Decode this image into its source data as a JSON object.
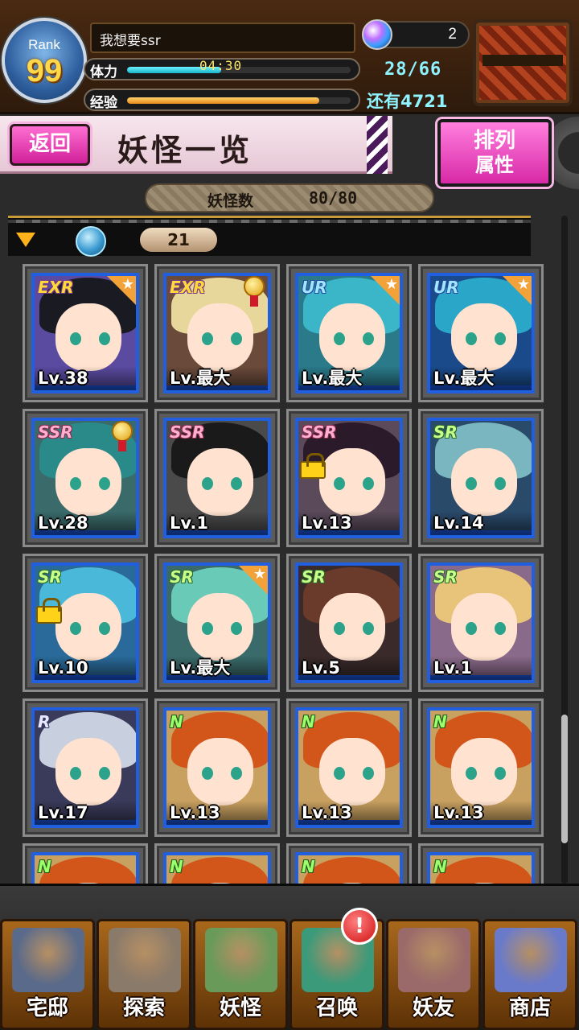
{
  "header": {
    "rank_label": "Rank",
    "rank_value": "99",
    "player_name": "我想要ssr",
    "stamina_label": "体力",
    "stamina_timer": "04:30",
    "stamina_fill": 0.42,
    "stamina_count": "28/66",
    "exp_label": "经验",
    "exp_fill": 0.86,
    "exp_remain": "还有4721",
    "orb_count": "2"
  },
  "title_bar": {
    "back_label": "返回",
    "title": "妖怪一览",
    "sort_line1": "排列",
    "sort_line2": "属性"
  },
  "count_bar": {
    "label": "妖怪数",
    "value": "80/80"
  },
  "filter": {
    "level_value": "21"
  },
  "cards": [
    {
      "rarity": "EXR",
      "lv": "Lv.38",
      "star": true,
      "medal": false,
      "lock": false,
      "hair": "#1a1a22",
      "bg": "#5a4aa0"
    },
    {
      "rarity": "EXR",
      "lv": "Lv.最大",
      "star": false,
      "medal": true,
      "lock": false,
      "hair": "#e7d79a",
      "bg": "#6a4a3a"
    },
    {
      "rarity": "UR",
      "lv": "Lv.最大",
      "star": true,
      "medal": false,
      "lock": false,
      "hair": "#3ab6c8",
      "bg": "#2a7a8a"
    },
    {
      "rarity": "UR",
      "lv": "Lv.最大",
      "star": true,
      "medal": false,
      "lock": false,
      "hair": "#2aa6c8",
      "bg": "#1a4a8a"
    },
    {
      "rarity": "SSR",
      "lv": "Lv.28",
      "star": false,
      "medal": true,
      "lock": false,
      "hair": "#2a8a8a",
      "bg": "#3a6a6a"
    },
    {
      "rarity": "SSR",
      "lv": "Lv.1",
      "star": false,
      "medal": false,
      "lock": false,
      "hair": "#1a1a1a",
      "bg": "#4a4a4a"
    },
    {
      "rarity": "SSR",
      "lv": "Lv.13",
      "star": false,
      "medal": false,
      "lock": true,
      "hair": "#2a1a2a",
      "bg": "#5a4a5a"
    },
    {
      "rarity": "SR",
      "lv": "Lv.14",
      "star": false,
      "medal": false,
      "lock": false,
      "hair": "#7ab6c0",
      "bg": "#2a4a6a"
    },
    {
      "rarity": "SR",
      "lv": "Lv.10",
      "star": false,
      "medal": false,
      "lock": true,
      "hair": "#4ab8d8",
      "bg": "#2a6a9a"
    },
    {
      "rarity": "SR",
      "lv": "Lv.最大",
      "star": true,
      "medal": false,
      "lock": false,
      "hair": "#6acab8",
      "bg": "#3a6a6a"
    },
    {
      "rarity": "SR",
      "lv": "Lv.5",
      "star": false,
      "medal": false,
      "lock": false,
      "hair": "#6a3a2a",
      "bg": "#3a2a2a"
    },
    {
      "rarity": "SR",
      "lv": "Lv.1",
      "star": false,
      "medal": false,
      "lock": false,
      "hair": "#e8c47a",
      "bg": "#8a6a8a"
    },
    {
      "rarity": "R",
      "lv": "Lv.17",
      "star": false,
      "medal": false,
      "lock": false,
      "hair": "#c8d0e0",
      "bg": "#3a3a5a"
    },
    {
      "rarity": "N",
      "lv": "Lv.13",
      "star": false,
      "medal": false,
      "lock": false,
      "hair": "#d2561a",
      "bg": "#c8a060"
    },
    {
      "rarity": "N",
      "lv": "Lv.13",
      "star": false,
      "medal": false,
      "lock": false,
      "hair": "#d2561a",
      "bg": "#c8a060"
    },
    {
      "rarity": "N",
      "lv": "Lv.13",
      "star": false,
      "medal": false,
      "lock": false,
      "hair": "#d2561a",
      "bg": "#c8a060"
    },
    {
      "rarity": "N",
      "lv": "",
      "star": false,
      "medal": false,
      "lock": false,
      "hair": "#d2561a",
      "bg": "#c8a060"
    },
    {
      "rarity": "N",
      "lv": "",
      "star": false,
      "medal": false,
      "lock": false,
      "hair": "#d2561a",
      "bg": "#c8a060"
    },
    {
      "rarity": "N",
      "lv": "",
      "star": false,
      "medal": false,
      "lock": false,
      "hair": "#d2561a",
      "bg": "#c8a060"
    },
    {
      "rarity": "N",
      "lv": "",
      "star": false,
      "medal": false,
      "lock": false,
      "hair": "#d2561a",
      "bg": "#c8a060"
    }
  ],
  "nav": [
    {
      "label": "宅邸",
      "art": "#5a6a8a"
    },
    {
      "label": "探索",
      "art": "#8a7a6a"
    },
    {
      "label": "妖怪",
      "art": "#6a9a5a"
    },
    {
      "label": "召唤",
      "art": "#3a9a7a"
    },
    {
      "label": "妖友",
      "art": "#9a6a6a"
    },
    {
      "label": "商店",
      "art": "#6a7aca"
    }
  ],
  "nav_badge": "!"
}
